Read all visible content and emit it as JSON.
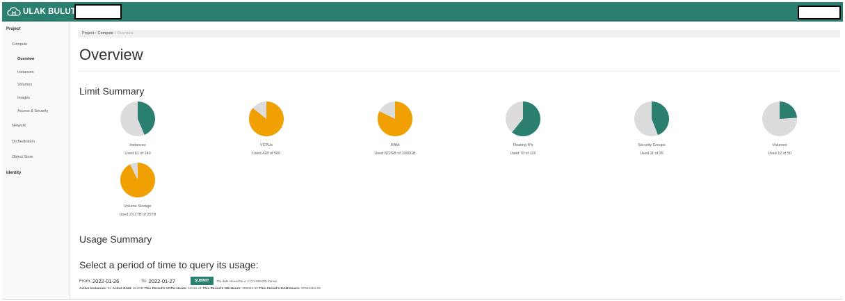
{
  "brand": {
    "name": "ULAK BULUT",
    "accent": "#2a7f6f"
  },
  "sidebar": {
    "items": [
      {
        "label": "Project"
      },
      {
        "label": "Compute"
      },
      {
        "label": "Overview"
      },
      {
        "label": "Instances"
      },
      {
        "label": "Volumes"
      },
      {
        "label": "Images"
      },
      {
        "label": "Access & Security"
      },
      {
        "label": "Network"
      },
      {
        "label": "Orchestration"
      },
      {
        "label": "Object Store"
      },
      {
        "label": "Identity"
      }
    ]
  },
  "breadcrumb": {
    "items": [
      "Project",
      "Compute",
      "Overview"
    ]
  },
  "page": {
    "title": "Overview"
  },
  "limit_summary": {
    "title": "Limit Summary",
    "charts": [
      {
        "label": "Instances",
        "used_text": "Used 61 of 140",
        "used": 61,
        "total": 140,
        "color": "#2a7f6f"
      },
      {
        "label": "VCPUs",
        "used_text": "Used 428 of 500",
        "used": 428,
        "total": 500,
        "color": "#f0a000"
      },
      {
        "label": "RAM",
        "used_text": "Used 822GB of 1000GB",
        "used": 822,
        "total": 1000,
        "color": "#f0a000"
      },
      {
        "label": "Floating IPs",
        "used_text": "Used 70 of 115",
        "used": 70,
        "total": 115,
        "color": "#2a7f6f"
      },
      {
        "label": "Security Groups",
        "used_text": "Used 11 of 25",
        "used": 11,
        "total": 25,
        "color": "#2a7f6f"
      },
      {
        "label": "Volumes",
        "used_text": "Used 12 of 50",
        "used": 12,
        "total": 50,
        "color": "#2a7f6f"
      },
      {
        "label": "Volume Storage",
        "used_text": "Used 23.2TB of 25TB",
        "used": 23.2,
        "total": 25,
        "color": "#f0a000"
      }
    ],
    "track_color": "#dcdcdc"
  },
  "usage_summary": {
    "title": "Usage Summary",
    "query_title": "Select a period of time to query its usage:",
    "from_label": "From:",
    "from_value": "2022-01-26",
    "to_label": "To:",
    "to_value": "2022-01-27",
    "submit_label": "SUBMIT",
    "help_text": "The date should be in YYYY-MM-DD format.",
    "totals": {
      "active_instances_label": "Active Instances:",
      "active_instances_value": "61",
      "active_ram_label": "Active RAM:",
      "active_ram_value": "842GB",
      "vcpu_hours_label": "This Period's VCPU-Hours:",
      "vcpu_hours_value": "19115.21",
      "gb_hours_label": "This Period's GB-Hours:",
      "gb_hours_value": "266334.62",
      "ram_hours_label": "This Period's RAM-Hours:",
      "ram_hours_value": "37664254.05"
    }
  }
}
